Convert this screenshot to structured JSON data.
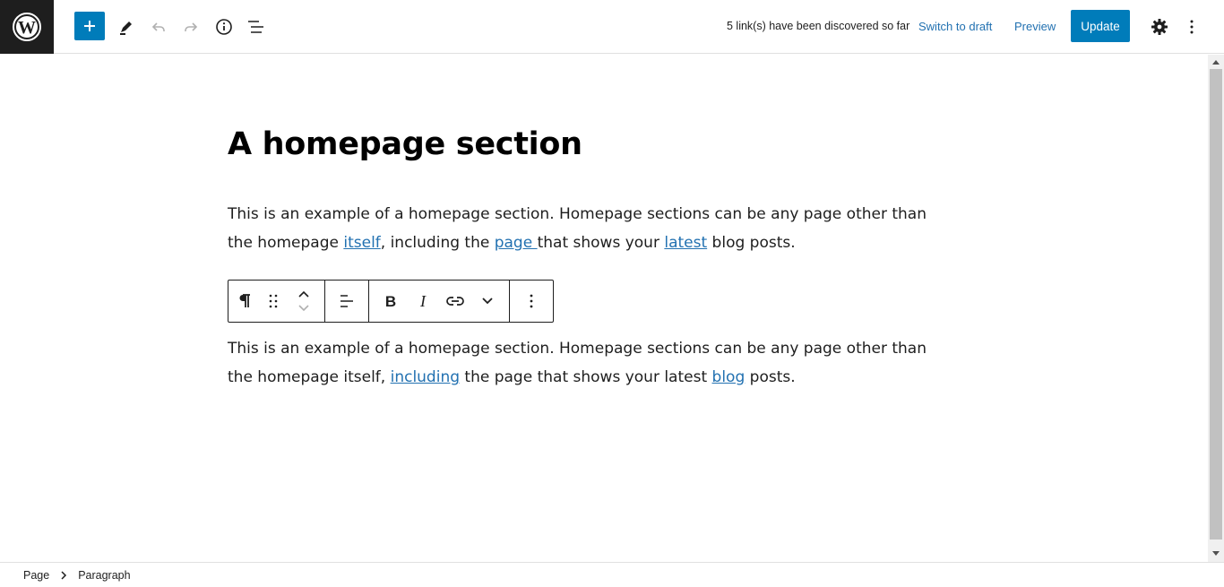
{
  "header": {
    "status_text": "5 link(s) have been discovered so far",
    "switch_to_draft_label": "Switch to draft",
    "preview_label": "Preview",
    "update_label": "Update",
    "accent_color": "#007cba"
  },
  "icons": {
    "logo": "wordpress-logo-icon",
    "add": "plus-icon",
    "tools": "pencil-icon",
    "undo": "undo-icon",
    "redo": "redo-icon",
    "details": "info-icon",
    "list_view": "list-view-icon",
    "settings": "gear-icon",
    "options": "more-vertical-icon"
  },
  "editor": {
    "title": "A homepage section",
    "paragraph1": {
      "t1": "This is an example of a homepage section. Homepage sections can be any page other than the homepage ",
      "link1": "itself",
      "t2": ", including the ",
      "link2": "page ",
      "t3": "that shows your ",
      "link3": "latest",
      "t4": " blog posts."
    },
    "paragraph2": {
      "t1": "This is an example of a homepage section. Homepage sections can be any page other than the homepage itself, ",
      "link1": "including",
      "t2": " the page that shows your latest ",
      "link2": "blog",
      "t3": " posts."
    }
  },
  "block_toolbar": {
    "icons": [
      "paragraph-icon",
      "drag-handle-icon",
      "move-up-icon",
      "move-down-icon",
      "align-left-icon",
      "bold-icon",
      "italic-icon",
      "link-icon",
      "chevron-down-icon",
      "more-vertical-icon"
    ]
  },
  "breadcrumb": {
    "items": [
      "Page",
      "Paragraph"
    ]
  }
}
